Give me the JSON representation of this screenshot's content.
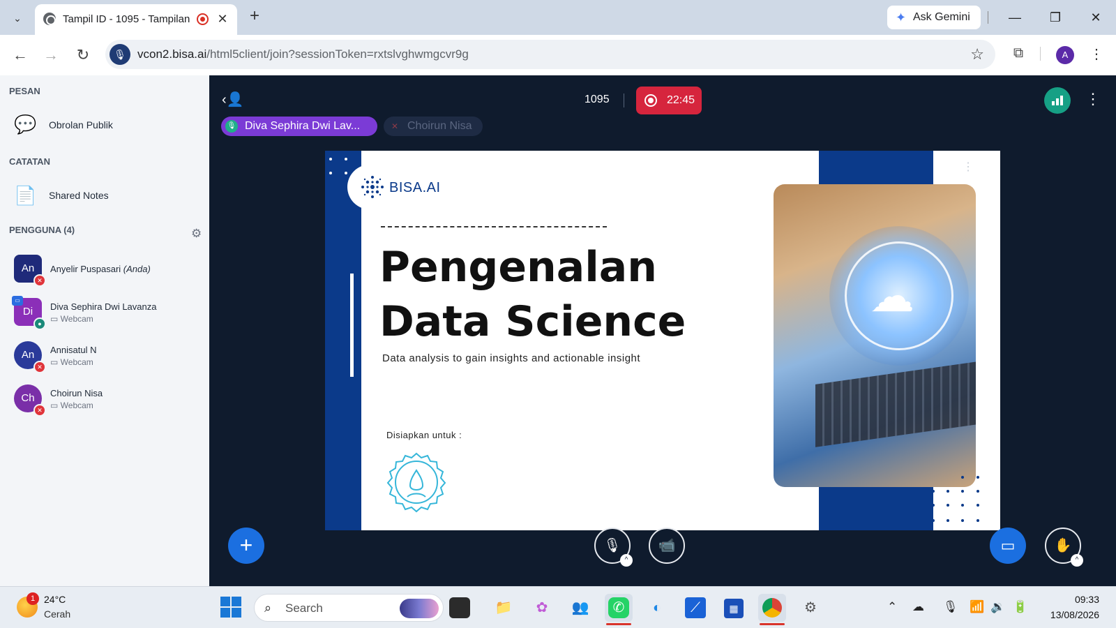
{
  "browser": {
    "tab_title": "Tampil ID - 1095 - Tampilan",
    "tab_close": "✕",
    "new_tab": "+",
    "gemini_label": "Ask Gemini",
    "url_host": "vcon2.bisa.ai",
    "url_path": "/html5client/join?sessionToken=rxtslvghwmgcvr9g",
    "profile_initial": "A"
  },
  "sidebar": {
    "messages_title": "PESAN",
    "public_chat": "Obrolan Publik",
    "notes_title": "CATATAN",
    "shared_notes": "Shared Notes",
    "users_title": "PENGGUNA (4)",
    "users": [
      {
        "initials": "An",
        "name": "Anyelir Puspasari",
        "you": "(Anda)",
        "sub": "",
        "color": "#1f2a7a",
        "mic": "muted"
      },
      {
        "initials": "Di",
        "name": "Diva Sephira Dwi Lavanza",
        "you": "",
        "sub": "Webcam",
        "color": "#8b2fb8",
        "mic": "on"
      },
      {
        "initials": "An",
        "name": "Annisatul N",
        "you": "",
        "sub": "Webcam",
        "color": "#2a3a9a",
        "mic": "muted"
      },
      {
        "initials": "Ch",
        "name": "Choirun Nisa",
        "you": "",
        "sub": "Webcam",
        "color": "#7a2fa8",
        "mic": "muted"
      }
    ]
  },
  "meeting": {
    "id": "1095",
    "rec_time": "22:45",
    "talking": "Diva Sephira Dwi Lav...",
    "talking_muted": "Choirun Nisa"
  },
  "slide": {
    "logo": "BISA.AI",
    "title_line1": "Pengenalan",
    "title_line2": "Data Science",
    "subtitle": "Data analysis to gain insights and actionable insight",
    "prepared_for": "Disiapkan untuk :"
  },
  "taskbar": {
    "weather_badge": "1",
    "temperature": "24°C",
    "condition": "Cerah",
    "search_label": "Search",
    "time": "09:33",
    "date": "13/08/2026"
  },
  "colors": {
    "accent": "#1b6fe0",
    "record": "#d6253d",
    "slide_blue": "#0b3a8a",
    "meeting_bg": "#0f1b2d"
  }
}
